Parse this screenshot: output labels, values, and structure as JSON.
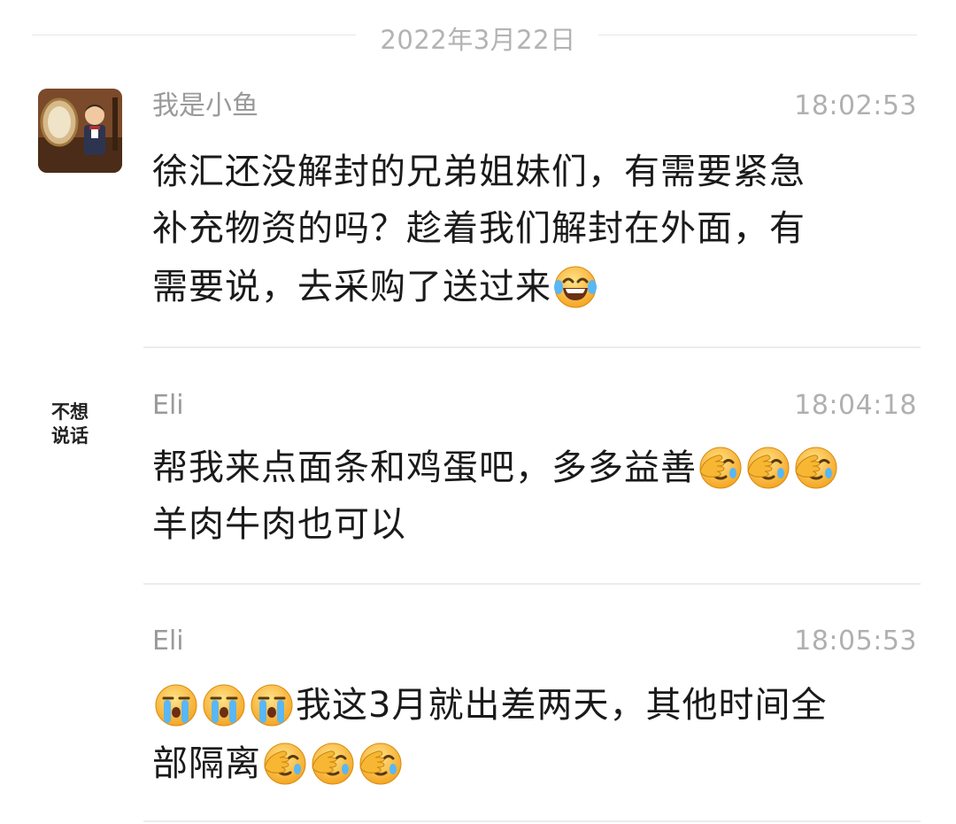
{
  "date_separator": "2022年3月22日",
  "messages": [
    {
      "sender": "我是小鱼",
      "time": "18:02:53",
      "avatar": "photo-avatar",
      "text_line1": "徐汇还没解封的兄弟姐妹们，有需要紧急",
      "text_line2": "补充物资的吗？趁着我们解封在外面，有",
      "text_line3": "需要说，去采购了送过来",
      "emojis": [
        "laugh-cry-emoji"
      ]
    },
    {
      "sender": "Eli",
      "time": "18:04:18",
      "avatar_text": "不想\n说话",
      "text_line1": "帮我来点面条和鸡蛋吧，多多益善",
      "text_line2": "羊肉牛肉也可以",
      "emojis": [
        "facepalm-emoji",
        "facepalm-emoji",
        "facepalm-emoji"
      ]
    },
    {
      "sender": "Eli",
      "time": "18:05:53",
      "text_line1": "我这3月就出差两天，其他时间全",
      "text_line2": "部隔离",
      "emojis_before": [
        "crying-emoji",
        "crying-emoji",
        "crying-emoji"
      ],
      "emojis_after": [
        "facepalm-emoji",
        "facepalm-emoji",
        "facepalm-emoji"
      ]
    }
  ],
  "colors": {
    "background": "#ffffff",
    "text": "#1a1a1a",
    "meta": "#9a9a9a",
    "divider": "#ececec",
    "emoji_face": "#fbc43b"
  }
}
